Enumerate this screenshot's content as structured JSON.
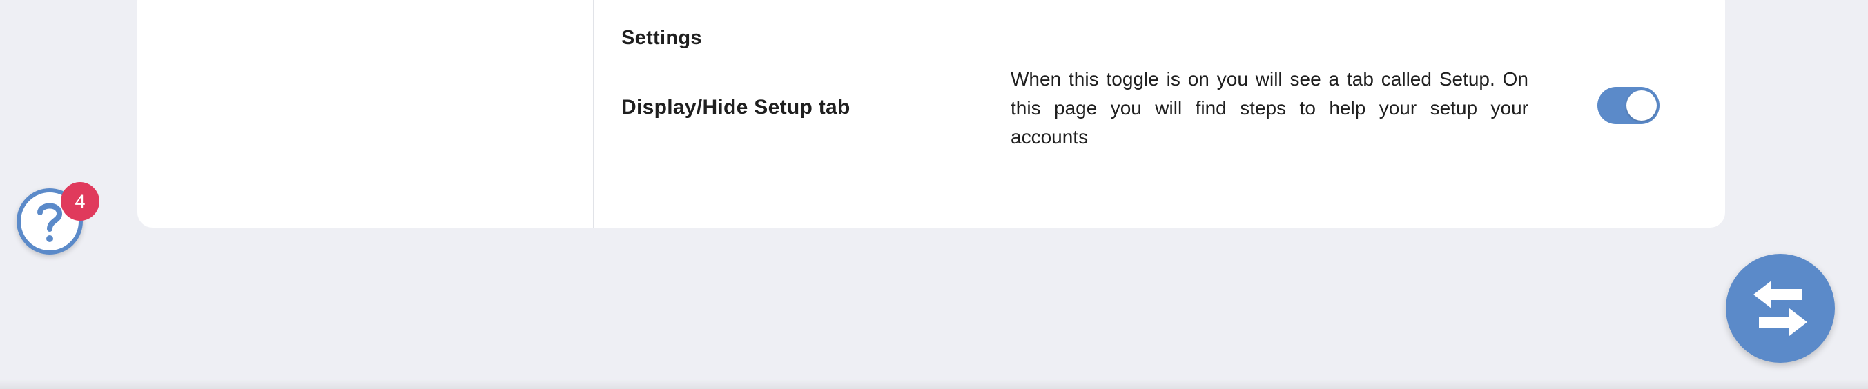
{
  "settings": {
    "section_title": "Settings",
    "items": [
      {
        "label": "Display/Hide Setup tab",
        "description": "When this toggle is on you will see a tab called Setup. On this page you will find steps to help your setup your accounts",
        "enabled": true
      }
    ]
  },
  "help": {
    "icon": "question-icon",
    "badge_count": "4"
  },
  "fab": {
    "icon": "swap-arrows-icon"
  },
  "colors": {
    "accent": "#5b8ac9",
    "badge": "#e03a5c",
    "background": "#eeeff4"
  }
}
